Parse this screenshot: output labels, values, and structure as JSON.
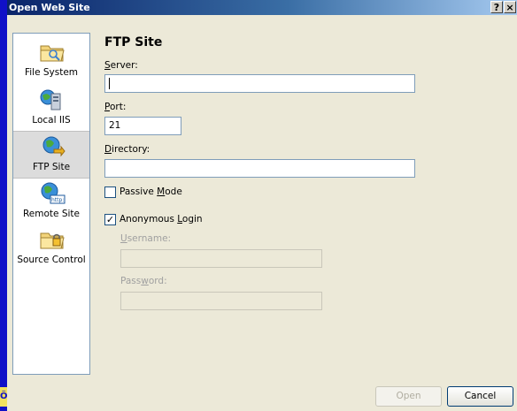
{
  "window": {
    "title": "Open Web Site",
    "help_glyph": "?",
    "close_glyph": "×"
  },
  "locations": [
    {
      "label": "File System",
      "icon": "folder-icon"
    },
    {
      "label": "Local IIS",
      "icon": "server-icon"
    },
    {
      "label": "FTP Site",
      "icon": "globe-ftp-icon",
      "selected": true
    },
    {
      "label": "Remote Site",
      "icon": "globe-http-icon"
    },
    {
      "label": "Source Control",
      "icon": "source-control-folder-icon"
    }
  ],
  "form": {
    "heading": "FTP Site",
    "server": {
      "label_accel": "S",
      "label_rest": "erver:",
      "value": ""
    },
    "port": {
      "label_accel": "P",
      "label_rest": "ort:",
      "value": "21"
    },
    "directory": {
      "label_accel": "D",
      "label_rest": "irectory:",
      "value": ""
    },
    "passive": {
      "label_pre": "Passive ",
      "label_accel": "M",
      "label_rest": "ode",
      "checked": false
    },
    "anonymous": {
      "label_pre": "Anonymous ",
      "label_accel": "L",
      "label_rest": "ogin",
      "checked": true,
      "check_glyph": "✓"
    },
    "username": {
      "label_accel": "U",
      "label_rest": "sername:",
      "value": ""
    },
    "password": {
      "label_pre": "Pass",
      "label_accel": "w",
      "label_rest": "ord:",
      "value": ""
    }
  },
  "buttons": {
    "open": "Open",
    "cancel": "Cancel"
  },
  "colors": {
    "desktop": "#1010c8",
    "titlebar_start": "#0a246a",
    "titlebar_end": "#a6caf0",
    "dialog_bg": "#ece9d8",
    "field_border": "#7f9db9"
  },
  "left_edge_glyph": "Ö"
}
